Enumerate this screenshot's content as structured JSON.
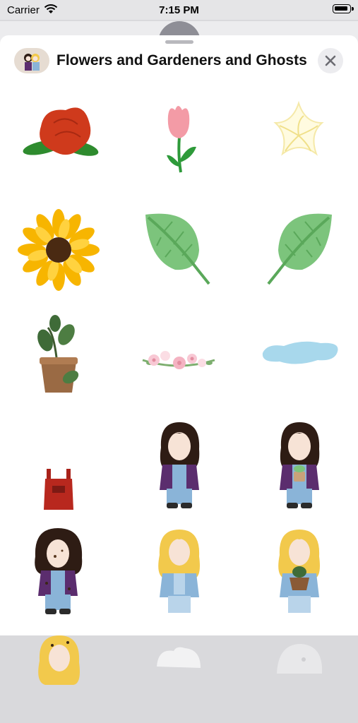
{
  "status_bar": {
    "carrier": "Carrier",
    "time": "7:15 PM"
  },
  "sheet": {
    "title": "Flowers and Gardeners and Ghosts",
    "close_icon": "close-icon"
  },
  "stickers": [
    {
      "name": "rose"
    },
    {
      "name": "tulip"
    },
    {
      "name": "white-flower"
    },
    {
      "name": "sunflower"
    },
    {
      "name": "leaf-left"
    },
    {
      "name": "leaf-right"
    },
    {
      "name": "potted-plant"
    },
    {
      "name": "flower-garland"
    },
    {
      "name": "puddle"
    },
    {
      "name": "overalls"
    },
    {
      "name": "gardener-brunette"
    },
    {
      "name": "gardener-brunette-holding-plant"
    },
    {
      "name": "gardener-brunette-dirty"
    },
    {
      "name": "gardener-blonde"
    },
    {
      "name": "gardener-blonde-holding-pot"
    },
    {
      "name": "gardener-blonde-partial"
    },
    {
      "name": "ghost-partial"
    },
    {
      "name": "ghost-partial"
    }
  ],
  "colors": {
    "sheet_background": "#ffffff",
    "close_button": "#ececef",
    "brunette_hair": "#2e1c14",
    "blonde_hair": "#f2c94c",
    "jacket": "#5b2d6e",
    "denim": "#8ab4d8"
  }
}
